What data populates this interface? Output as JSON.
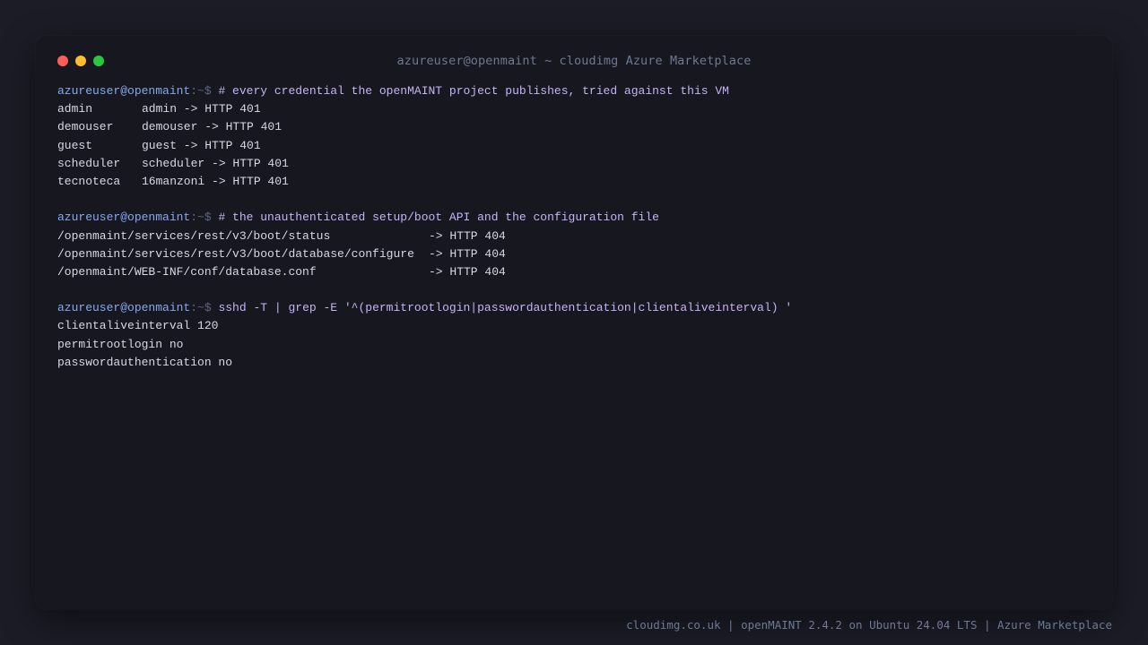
{
  "window": {
    "title": "azureuser@openmaint ~ cloudimg Azure Marketplace",
    "controls": {
      "close_color": "#ff5f57",
      "minimize_color": "#febc2e",
      "maximize_color": "#28c840"
    }
  },
  "prompt": {
    "user_host": "azureuser@openmaint",
    "path_symbol": ":~$"
  },
  "blocks": [
    {
      "command": "# every credential the openMAINT project publishes, tried against this VM",
      "rows": [
        {
          "user": "admin",
          "result": "admin -> HTTP 401"
        },
        {
          "user": "demouser",
          "result": "demouser -> HTTP 401"
        },
        {
          "user": "guest",
          "result": "guest -> HTTP 401"
        },
        {
          "user": "scheduler",
          "result": "scheduler -> HTTP 401"
        },
        {
          "user": "tecnoteca",
          "result": "16manzoni -> HTTP 401"
        }
      ]
    },
    {
      "command": "# the unauthenticated setup/boot API and the configuration file",
      "rows": [
        {
          "path": "/openmaint/services/rest/v3/boot/status",
          "result": "-> HTTP 404"
        },
        {
          "path": "/openmaint/services/rest/v3/boot/database/configure",
          "result": "-> HTTP 404"
        },
        {
          "path": "/openmaint/WEB-INF/conf/database.conf",
          "result": "-> HTTP 404"
        }
      ]
    },
    {
      "command": "sshd -T | grep -E '^(permitrootlogin|passwordauthentication|clientaliveinterval) '",
      "rows": [
        "clientaliveinterval 120",
        "permitrootlogin no",
        "passwordauthentication no"
      ]
    }
  ],
  "footer": "cloudimg.co.uk | openMAINT 2.4.2 on Ubuntu 24.04 LTS | Azure Marketplace",
  "colors": {
    "background": "#1b1c25",
    "terminal": "#16171f",
    "prompt": "#86a9f0",
    "command": "#c6b4f5",
    "output": "#d6d8e4"
  }
}
